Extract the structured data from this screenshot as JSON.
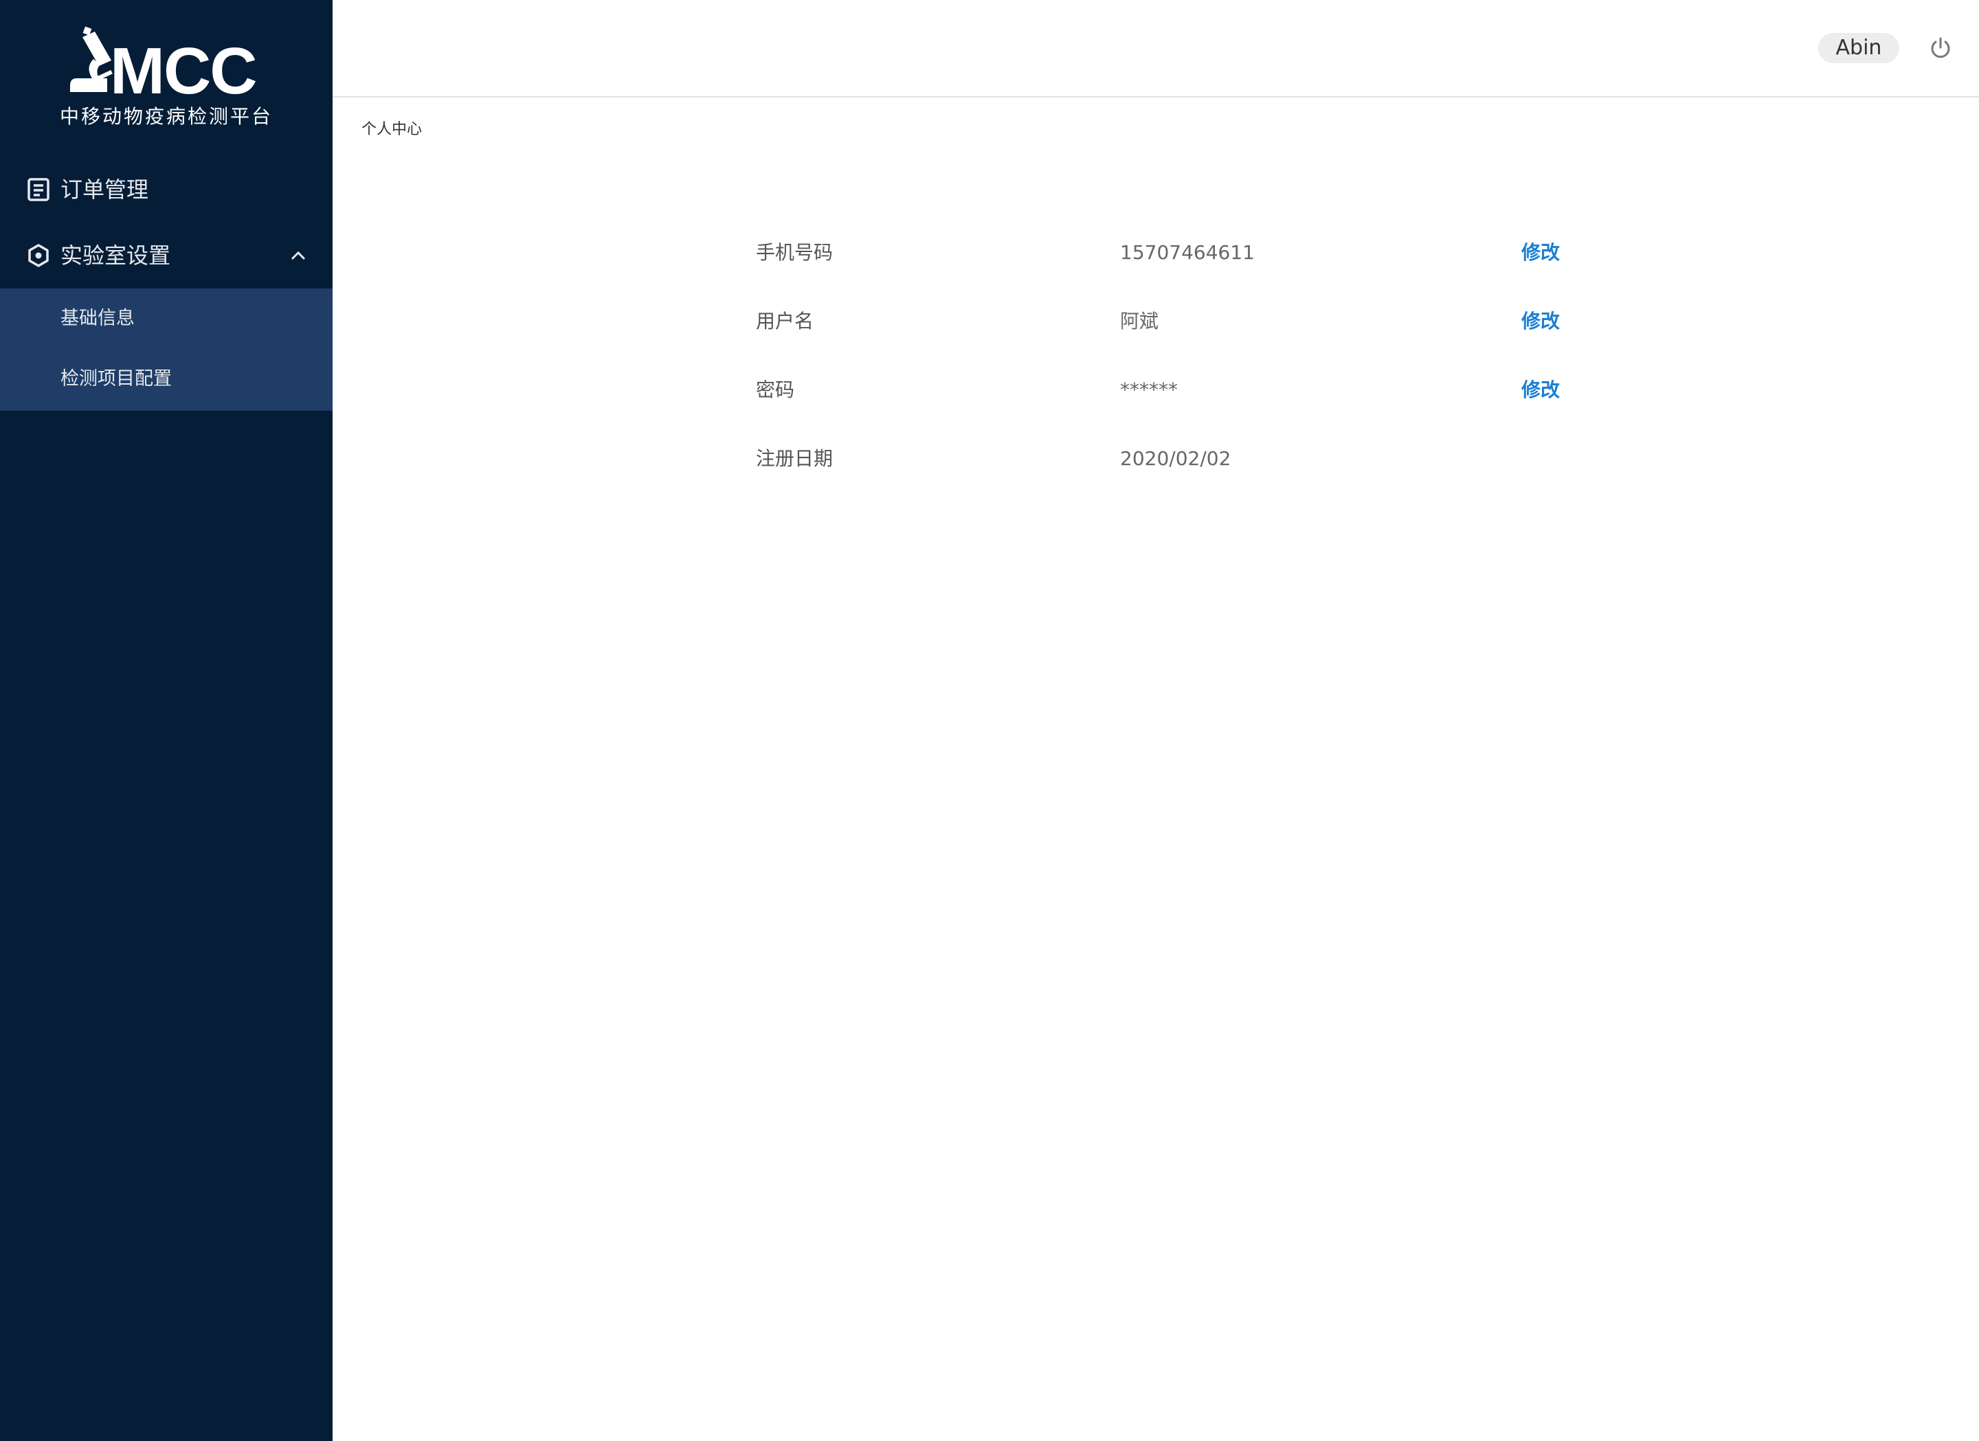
{
  "sidebar": {
    "logo_text": "MCC",
    "logo_subtitle": "中移动物疫病检测平台",
    "items": [
      {
        "label": "订单管理",
        "icon": "document-list-icon"
      },
      {
        "label": "实验室设置",
        "icon": "settings-hexagon-icon",
        "expanded": true,
        "children": [
          {
            "label": "基础信息"
          },
          {
            "label": "检测项目配置"
          }
        ]
      }
    ],
    "colors": {
      "background": "#061d37",
      "submenu_background": "#1f3d66"
    }
  },
  "header": {
    "user_name": "Abin",
    "logout_icon": "power-icon"
  },
  "breadcrumb": "个人中心",
  "profile": {
    "rows": [
      {
        "label": "手机号码",
        "value": "15707464611",
        "action": "修改"
      },
      {
        "label": "用户名",
        "value": "阿斌",
        "action": "修改"
      },
      {
        "label": "密码",
        "value": "******",
        "action": "修改"
      },
      {
        "label": "注册日期",
        "value": "2020/02/02",
        "action": ""
      }
    ]
  },
  "colors": {
    "accent": "#1a7fd4"
  }
}
